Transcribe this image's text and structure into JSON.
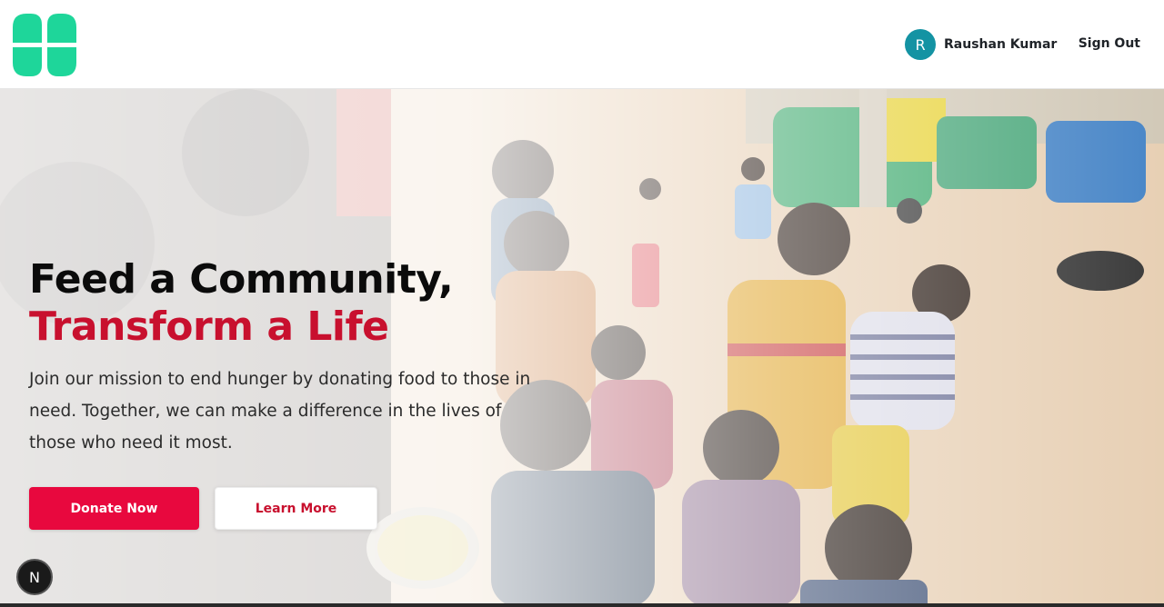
{
  "header": {
    "logo_icon": "four-petal-clover-logo",
    "logo_color": "#1ed69a",
    "user": {
      "avatar_initial": "R",
      "avatar_color": "#1493a3",
      "name": "Raushan Kumar"
    },
    "signout_label": "Sign Out"
  },
  "hero": {
    "background": "photo-children-receiving-food",
    "title_line1": "Feed a Community,",
    "title_line2": "Transform a Life",
    "title_accent_color": "#c8102e",
    "description": "Join our mission to end hunger by donating food to those in need. Together, we can make a difference in the lives of those who need it most.",
    "donate_label": "Donate Now",
    "donate_color": "#e8083e",
    "learn_label": "Learn More"
  },
  "dev_badge": {
    "label": "N",
    "icon": "nextjs-icon"
  }
}
